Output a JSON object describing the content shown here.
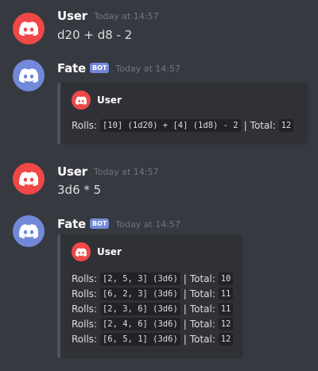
{
  "colors": {
    "background": "#36393f",
    "user_avatar": "#f04747",
    "bot_avatar": "#7289da",
    "bot_tag": "#7289da",
    "embed_bg": "#2f3136",
    "embed_border": "#4f545c",
    "code_bg": "#202225"
  },
  "icons": {
    "avatar": "discord-logo-icon"
  },
  "messages": [
    {
      "author": "User",
      "timestamp": "Today at 14:57",
      "content": "d20 + d8 - 2"
    },
    {
      "author": "Fate",
      "bot_tag": "BOT",
      "timestamp": "Today at 14:57",
      "embed": {
        "author": "User",
        "lines": [
          {
            "label": "Rolls:",
            "code": "[10] (1d20) + [4] (1d8) - 2",
            "separator": "|",
            "total_label": "Total:",
            "total": "12"
          }
        ]
      }
    },
    {
      "author": "User",
      "timestamp": "Today at 14:57",
      "content": "3d6 * 5"
    },
    {
      "author": "Fate",
      "bot_tag": "BOT",
      "timestamp": "Today at 14:57",
      "embed": {
        "author": "User",
        "lines": [
          {
            "label": "Rolls:",
            "code": "[2, 5, 3] (3d6)",
            "separator": "|",
            "total_label": "Total:",
            "total": "10"
          },
          {
            "label": "Rolls:",
            "code": "[6, 2, 3] (3d6)",
            "separator": "|",
            "total_label": "Total:",
            "total": "11"
          },
          {
            "label": "Rolls:",
            "code": "[2, 3, 6] (3d6)",
            "separator": "|",
            "total_label": "Total:",
            "total": "11"
          },
          {
            "label": "Rolls:",
            "code": "[2, 4, 6] (3d6)",
            "separator": "|",
            "total_label": "Total:",
            "total": "12"
          },
          {
            "label": "Rolls:",
            "code": "[6, 5, 1] (3d6)",
            "separator": "|",
            "total_label": "Total:",
            "total": "12"
          }
        ]
      }
    }
  ]
}
